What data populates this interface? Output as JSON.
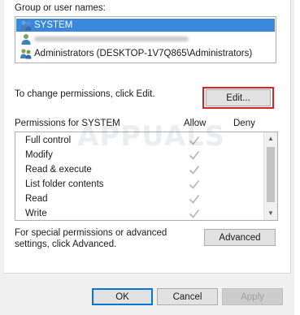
{
  "users": {
    "label": "Group or user names:",
    "items": [
      {
        "name": "SYSTEM",
        "selected": true,
        "icon": "group-users-icon"
      },
      {
        "name": "",
        "blurred": true,
        "icon": "single-user-icon"
      },
      {
        "name": "Administrators (DESKTOP-1V7Q865\\Administrators)",
        "icon": "group-users-icon"
      }
    ]
  },
  "change": {
    "text": "To change permissions, click Edit.",
    "edit_label": "Edit..."
  },
  "permissions": {
    "title": "Permissions for SYSTEM",
    "allow_header": "Allow",
    "deny_header": "Deny",
    "rows": [
      {
        "name": "Full control",
        "allow": true,
        "deny": false
      },
      {
        "name": "Modify",
        "allow": true,
        "deny": false
      },
      {
        "name": "Read & execute",
        "allow": true,
        "deny": false
      },
      {
        "name": "List folder contents",
        "allow": true,
        "deny": false
      },
      {
        "name": "Read",
        "allow": true,
        "deny": false
      },
      {
        "name": "Write",
        "allow": true,
        "deny": false
      }
    ]
  },
  "special": {
    "text": "For special permissions or advanced settings, click Advanced.",
    "advanced_label": "Advanced"
  },
  "footer": {
    "ok_label": "OK",
    "cancel_label": "Cancel",
    "apply_label": "Apply"
  },
  "watermark": "APPUALS",
  "colors": {
    "selection": "#3b87d9",
    "highlight": "#e02020",
    "check": "#b5b5b5"
  }
}
